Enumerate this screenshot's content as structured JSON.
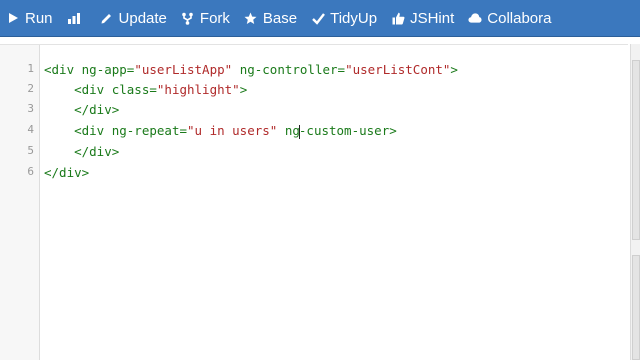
{
  "toolbar": {
    "items": [
      {
        "label": "Run",
        "icon": "play-icon"
      },
      {
        "label": "",
        "icon": "bar-chart-icon"
      },
      {
        "label": "Update",
        "icon": "pencil-icon"
      },
      {
        "label": "Fork",
        "icon": "fork-icon"
      },
      {
        "label": "Base",
        "icon": "star-icon"
      },
      {
        "label": "TidyUp",
        "icon": "check-icon"
      },
      {
        "label": "JSHint",
        "icon": "thumbs-up-icon"
      },
      {
        "label": "Collabora",
        "icon": "cloud-icon"
      }
    ],
    "bg_color": "#3b78be"
  },
  "editor": {
    "line_numbers": [
      "1",
      "2",
      "3",
      "4",
      "5",
      "6"
    ],
    "lines": [
      [
        {
          "t": "<div ",
          "c": "tag"
        },
        {
          "t": "ng-app=",
          "c": "attr"
        },
        {
          "t": "\"userListApp\"",
          "c": "val"
        },
        {
          "t": " ",
          "c": "plain"
        },
        {
          "t": "ng-controller=",
          "c": "attr"
        },
        {
          "t": "\"userListCont\"",
          "c": "val"
        },
        {
          "t": ">",
          "c": "tag"
        }
      ],
      [
        {
          "t": "    <div ",
          "c": "tag"
        },
        {
          "t": "class=",
          "c": "attr"
        },
        {
          "t": "\"highlight\"",
          "c": "val"
        },
        {
          "t": ">",
          "c": "tag"
        }
      ],
      [
        {
          "t": "    </div>",
          "c": "tag"
        }
      ],
      [
        {
          "t": "    <div ",
          "c": "tag"
        },
        {
          "t": "ng-repeat=",
          "c": "attr"
        },
        {
          "t": "\"u in users\"",
          "c": "val"
        },
        {
          "t": " ",
          "c": "plain"
        },
        {
          "t": "ng",
          "c": "attr"
        },
        {
          "t": "|cursor|",
          "c": "cursor"
        },
        {
          "t": "-custom-user",
          "c": "attr"
        },
        {
          "t": ">",
          "c": "tag"
        }
      ],
      [
        {
          "t": "    </div>",
          "c": "tag"
        }
      ],
      [
        {
          "t": "</div>",
          "c": "tag"
        }
      ]
    ]
  }
}
